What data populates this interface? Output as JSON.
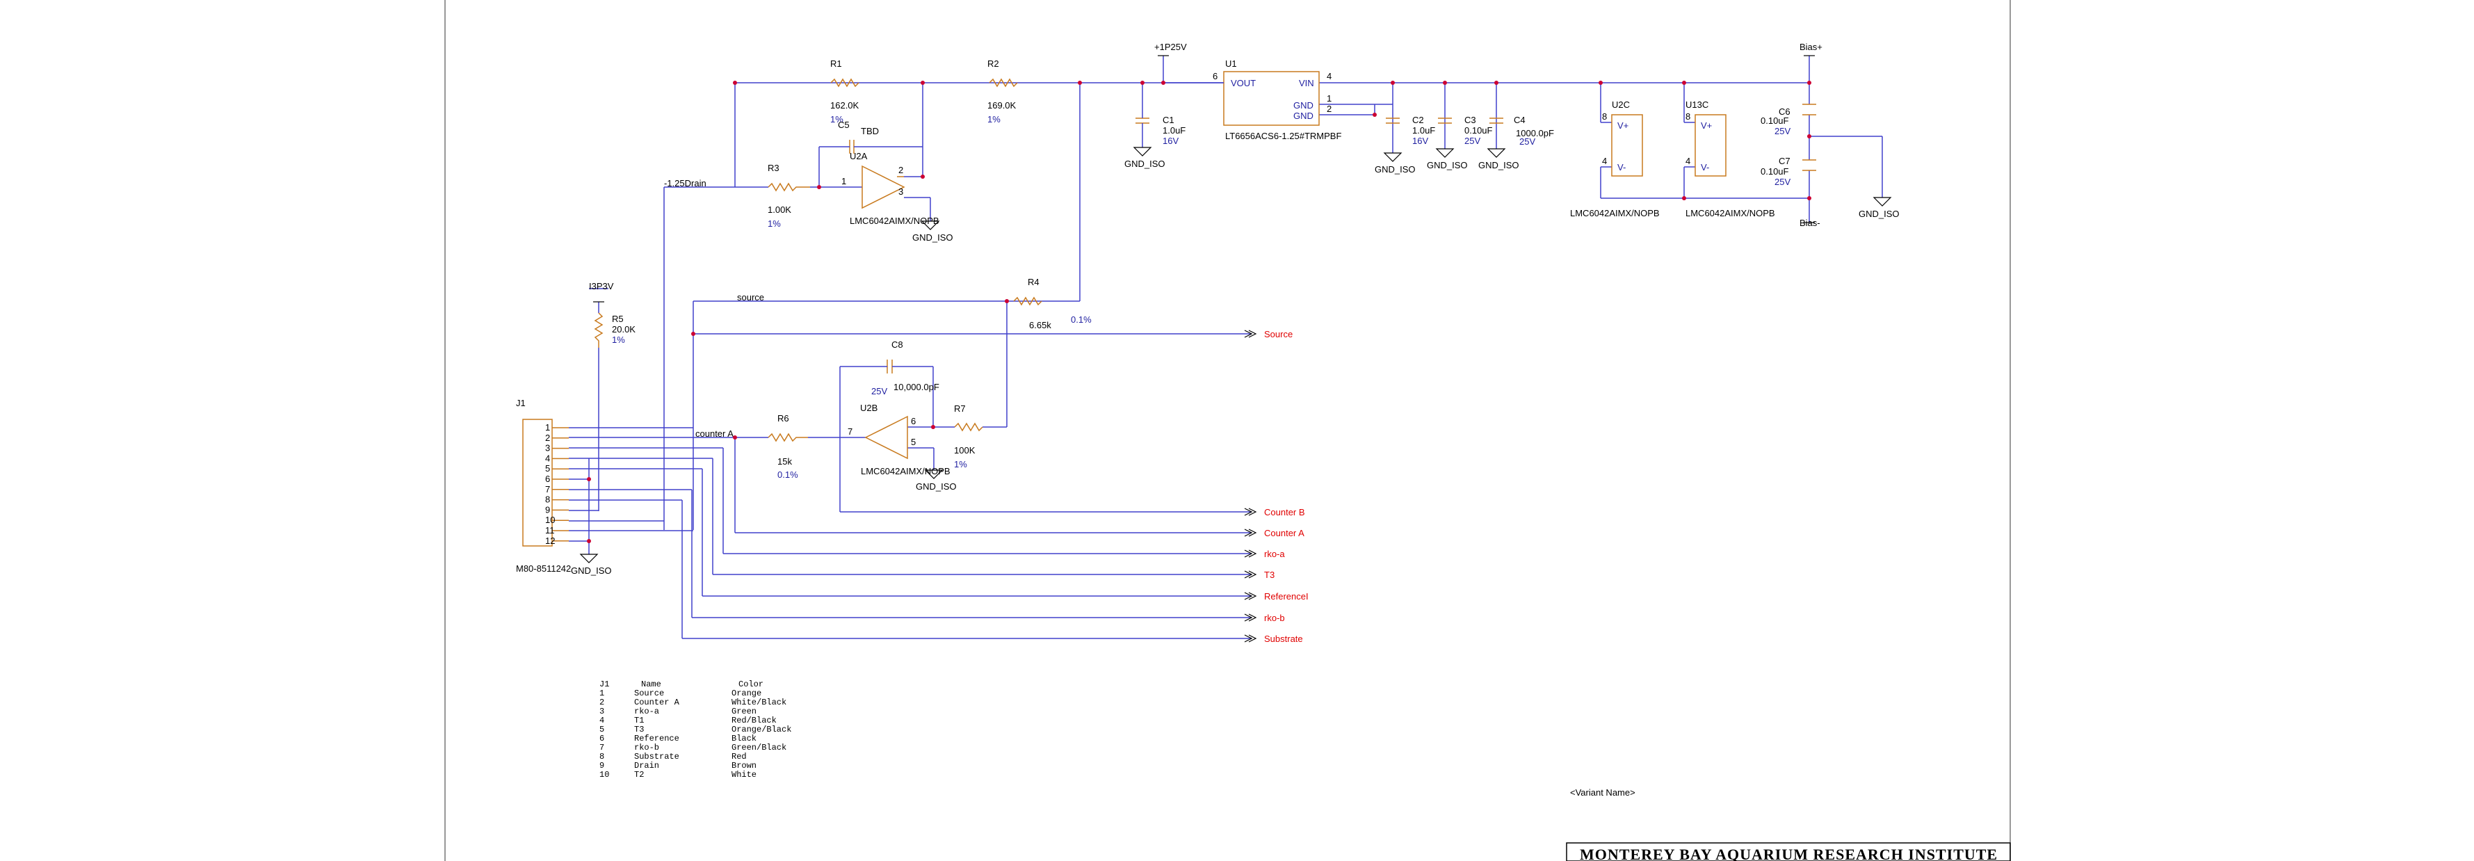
{
  "title_block": {
    "variant": "<Variant Name>",
    "org": "MONTEREY BAY AQUARIUM RESEARCH INSTITUTE"
  },
  "nets": {
    "p1p25v": "+1P25V",
    "i3p3v": "I3P3V",
    "drain": "-1.25Drain",
    "source": "source",
    "counter_a": "counter A",
    "bias_plus": "Bias+",
    "bias_minus": "Bias-"
  },
  "gnd_label": "GND_ISO",
  "components": {
    "r1": {
      "ref": "R1",
      "value": "162.0K",
      "tol": "1%"
    },
    "r2": {
      "ref": "R2",
      "value": "169.0K",
      "tol": "1%"
    },
    "r3": {
      "ref": "R3",
      "value": "1.00K",
      "tol": "1%"
    },
    "r4": {
      "ref": "R4",
      "value": "6.65k",
      "tol": "0.1%"
    },
    "r5": {
      "ref": "R5",
      "value": "20.0K",
      "tol": "1%"
    },
    "r6": {
      "ref": "R6",
      "value": "15k",
      "tol": "0.1%"
    },
    "r7": {
      "ref": "R7",
      "value": "100K",
      "tol": "1%"
    },
    "c1": {
      "ref": "C1",
      "value": "1.0uF",
      "volt": "16V"
    },
    "c2": {
      "ref": "C2",
      "value": "1.0uF",
      "volt": "16V"
    },
    "c3": {
      "ref": "C3",
      "value": "0.10uF",
      "volt": "25V"
    },
    "c4": {
      "ref": "C4",
      "value": "1000.0pF",
      "volt": "25V"
    },
    "c5": {
      "ref": "C5",
      "value": "TBD"
    },
    "c6": {
      "ref": "C6",
      "value": "0.10uF",
      "volt": "25V"
    },
    "c7": {
      "ref": "C7",
      "value": "0.10uF",
      "volt": "25V"
    },
    "c8": {
      "ref": "C8",
      "value": "10,000.0pF",
      "volt": "25V"
    },
    "u1": {
      "ref": "U1",
      "part": "LT6656ACS6-1.25#TRMPBF",
      "vout": "VOUT",
      "vin": "VIN",
      "gnd1": "GND",
      "gnd2": "GND"
    },
    "u2a": {
      "ref": "U2A",
      "part": "LMC6042AIMX/NOPB"
    },
    "u2b": {
      "ref": "U2B",
      "part": "LMC6042AIMX/NOPB"
    },
    "u2c": {
      "ref": "U2C",
      "part": "LMC6042AIMX/NOPB",
      "vplus": "V+",
      "vminus": "V-"
    },
    "u13c": {
      "ref": "U13C",
      "part": "LMC6042AIMX/NOPB",
      "vplus": "V+",
      "vminus": "V-"
    },
    "j1": {
      "ref": "J1",
      "part": "M80-8511242"
    }
  },
  "pins": {
    "u1_vout": "6",
    "u1_vin": "4",
    "u1_gnd1": "1",
    "u1_gnd2": "2",
    "u2a_out": "1",
    "u2a_inm": "2",
    "u2a_inp": "3",
    "u2b_out": "7",
    "u2b_inm": "6",
    "u2b_inp": "5",
    "u2c_vp": "8",
    "u2c_vm": "4",
    "u13c_vp": "8",
    "u13c_vm": "4"
  },
  "j1_pins": [
    "1",
    "2",
    "3",
    "4",
    "5",
    "6",
    "7",
    "8",
    "9",
    "10",
    "11",
    "12"
  ],
  "ports": [
    "Source",
    "Counter B",
    "Counter A",
    "rko-a",
    "T3",
    "ReferenceI",
    "rko-b",
    "Substrate"
  ],
  "pin_table": {
    "headers": [
      "J1",
      "Name",
      "Color"
    ],
    "rows": [
      [
        "1",
        "Source",
        "Orange"
      ],
      [
        "2",
        "Counter A",
        "White/Black"
      ],
      [
        "3",
        "rko-a",
        "Green"
      ],
      [
        "4",
        "T1",
        "Red/Black"
      ],
      [
        "5",
        "T3",
        "Orange/Black"
      ],
      [
        "6",
        "Reference",
        "Black"
      ],
      [
        "7",
        "rko-b",
        "Green/Black"
      ],
      [
        "8",
        "Substrate",
        "Red"
      ],
      [
        "9",
        "Drain",
        "Brown"
      ],
      [
        "10",
        "T2",
        "White"
      ]
    ]
  }
}
